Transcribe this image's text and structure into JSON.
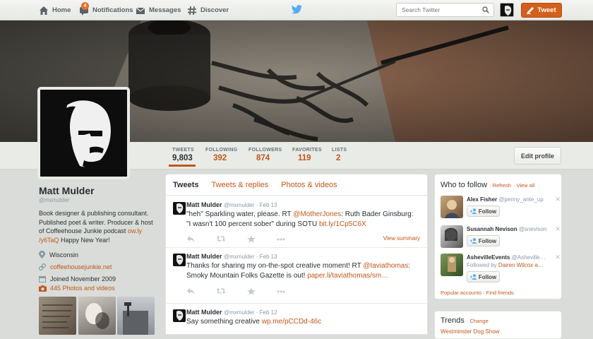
{
  "nav": {
    "home": "Home",
    "notifications": "Notifications",
    "notifications_count": "4",
    "messages": "Messages",
    "discover": "Discover",
    "search_placeholder": "Search Twitter",
    "tweet_button": "Tweet"
  },
  "colors": {
    "accent": "#c0571b",
    "tweet_button": "#d35f1c",
    "twitter_bird": "#55acee"
  },
  "profile_nav": {
    "stats": [
      {
        "label": "TWEETS",
        "value": "9,803"
      },
      {
        "label": "FOLLOWING",
        "value": "392"
      },
      {
        "label": "FOLLOWERS",
        "value": "874"
      },
      {
        "label": "FAVORITES",
        "value": "119"
      },
      {
        "label": "LISTS",
        "value": "2"
      }
    ],
    "edit_profile": "Edit profile"
  },
  "profile": {
    "name": "Matt Mulder",
    "handle": "@mxmulder",
    "bio": "Book designer & publishing consultant. Published poet & writer. Producer & host of Coffeehouse Junkie podcast",
    "bio_link": "ow.ly/y6TaQ",
    "bio_link_a": "ow.ly",
    "bio_link_b": "/y6TaQ",
    "bio_tail": "Happy New Year!",
    "location": "Wisconsin",
    "website": "coffeehousejunkie.net",
    "joined": "Joined November 2009",
    "photos": "445 Photos and videos"
  },
  "timeline": {
    "tabs": [
      "Tweets",
      "Tweets & replies",
      "Photos & videos"
    ],
    "tweets": [
      {
        "name": "Matt Mulder",
        "handle": "@mxmulder",
        "date": "· Feb 13",
        "t1": "\"heh\" Sparkling water, please. RT ",
        "mention": "@MotherJones",
        "t2": ": Ruth Bader Ginsburg:",
        "t3": "\"I wasn't 100 percent sober\" during SOTU  ",
        "link": "bit.ly/1Cp5C6X",
        "view_summary": "View summary"
      },
      {
        "name": "Matt Mulder",
        "handle": "@mxmulder",
        "date": "· Feb 13",
        "t1": "Thanks for sharing my on-the-spot creative moment! RT ",
        "mention": "@taviathomas",
        "t2": ":",
        "t3": "Smoky Mountain Folks Gazette is out! ",
        "link": "paper.li/taviathomas/sm…"
      },
      {
        "name": "Matt Mulder",
        "handle": "@mxmulder",
        "date": "· Feb 12",
        "t1": "Say something creative ",
        "link": "wp.me/pCCDd-46c"
      }
    ]
  },
  "who_to_follow": {
    "title": "Who to follow",
    "refresh": "· Refresh",
    "view_all": "· View all",
    "people": [
      {
        "name": "Alex Fisher",
        "handle": "@penny_ante_up",
        "follow": "Follow"
      },
      {
        "name": "Susannah Nevison",
        "handle": "@snevison",
        "follow": "Follow"
      },
      {
        "name": "AshevilleEvents",
        "handle": "@Asheville…",
        "followed_by": "Followed by",
        "followed_by_name": "Dairen Wilcox a…",
        "follow": "Follow"
      }
    ],
    "footer": "Popular accounts · Find friends"
  },
  "trends": {
    "title": "Trends",
    "change": "· Change",
    "first": "Westminster Dog Show"
  }
}
